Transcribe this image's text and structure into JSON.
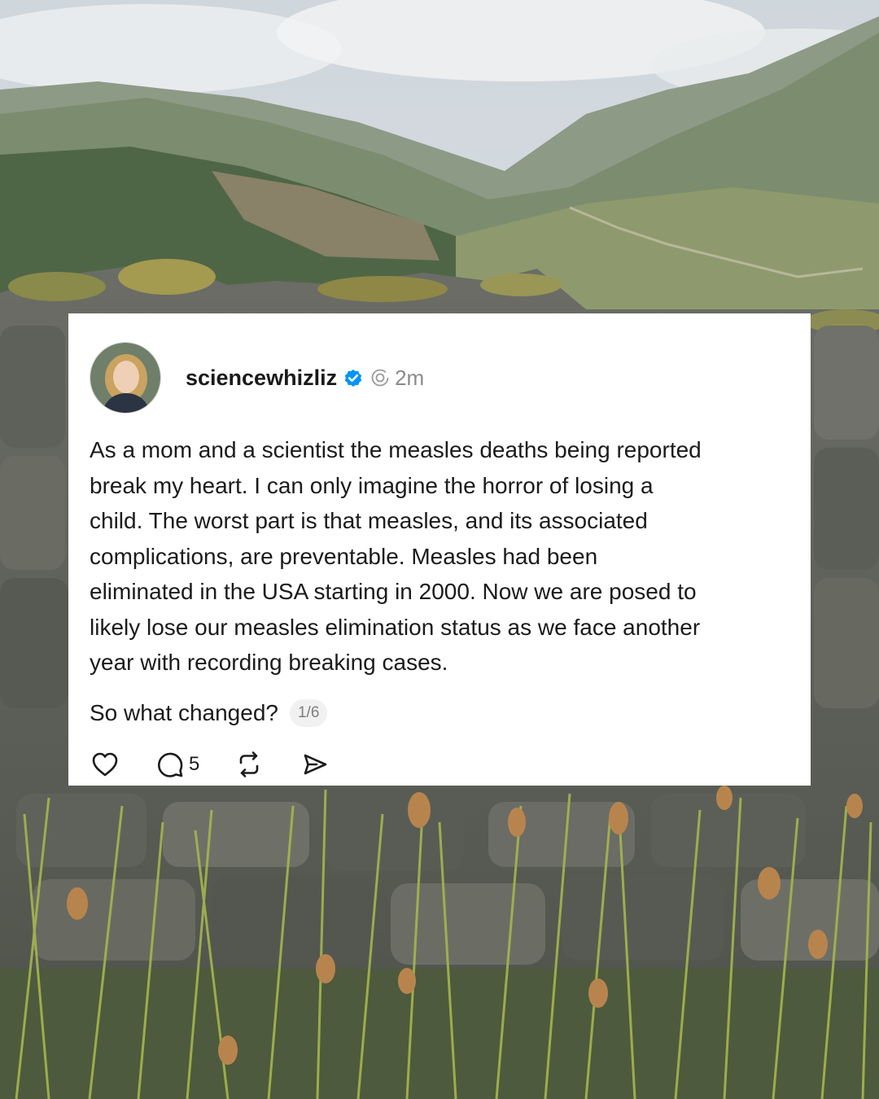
{
  "post": {
    "username": "sciencewhizliz",
    "time_ago": "2m",
    "body": "As a mom and a scientist the measles deaths being reported\nbreak my heart. I can only imagine the horror of losing a\nchild. The worst part is that measles, and its associated\ncomplications, are preventable. Measles had been\neliminated in the USA starting in 2000. Now we are posed to\nlikely lose our measles elimination status as we face another\nyear with recording breaking cases.",
    "continuation": "So what changed?",
    "page_indicator": "1/6",
    "reply_count": "5"
  },
  "icons": {
    "verified": "verified-badge-icon",
    "threads": "threads-logo-icon",
    "like": "heart-icon",
    "reply": "comment-icon",
    "repost": "repost-icon",
    "share": "share-icon"
  },
  "colors": {
    "verified_blue": "#0095f6",
    "card_background": "#ffffff",
    "text": "#1b1b1b",
    "muted": "#8a8a8a"
  }
}
